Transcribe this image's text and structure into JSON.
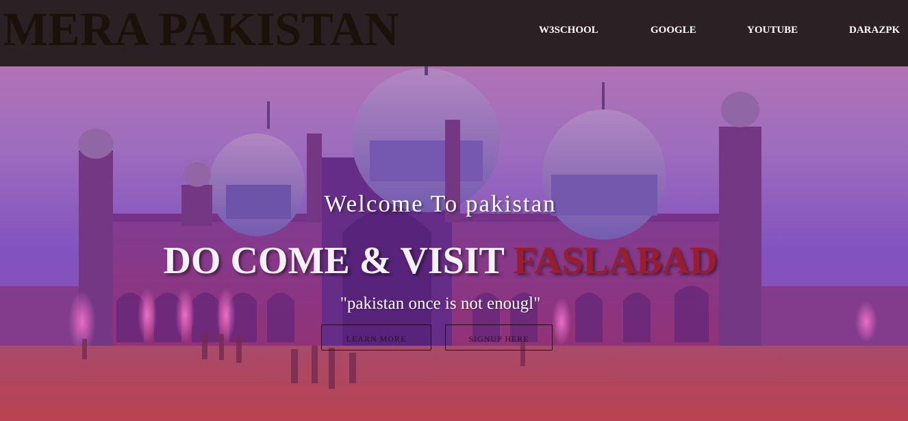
{
  "navbar": {
    "brand": "MERA PAKISTAN",
    "links": [
      "W3SCHOOL",
      "GOOGLE",
      "YOUTUBE",
      "DARAZPK"
    ]
  },
  "hero": {
    "welcome": "Welcome To pakistan",
    "headline_main": "DO COME & VISIT ",
    "headline_accent": "FASLABAD",
    "tagline": "\"pakistan once is not enougl\"",
    "buttons": {
      "learn_more": "LEARN MORE",
      "signup": "SIGNUP HERE"
    }
  },
  "colors": {
    "navbar_bg": "#2b2024",
    "brand_text": "#1c1108",
    "accent": "#9b1d2c",
    "hero_overlay_top": "#c77fb8",
    "hero_overlay_bottom": "#b8454f"
  },
  "icons": {
    "hero_image": "badshahi-mosque-photo"
  }
}
